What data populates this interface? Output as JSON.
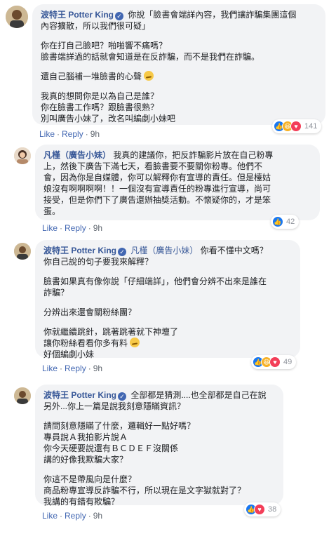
{
  "comments": [
    {
      "author": "波特王 Potter King",
      "mention": "",
      "paragraphs": [
        [
          "你說「臉書會端詳內容，我們讓詐騙集團這個",
          "內容擴散，所以我們很可疑」"
        ],
        [
          "你在打自己臉吧？啪啪響不痛嗎？",
          "臉書端詳過的話就會知道是在反詐騙，而不是我們在詐騙。"
        ],
        [
          "還自己腦補一堆臉書的心聲"
        ],
        [
          "我真的想問你是以為自己是誰？",
          "你在臉書工作嗎？跟臉書很熟？",
          "別叫廣告小妹了，改名叫編劇小妹吧"
        ]
      ],
      "actions": {
        "like": "Like",
        "reply": "Reply",
        "time": "9h"
      },
      "reactions": {
        "icons": [
          "like-icon",
          "haha-icon",
          "love-icon"
        ],
        "count": "141"
      }
    },
    {
      "author": "凡槿（廣告小妹）",
      "mention": "",
      "paragraphs": [
        [
          "我真的建議你，把反詐騙影片放在自己粉專",
          "上，然後下廣告下滿七天，看臉書要不要關你粉專。他們不",
          "會，因為你是自媒體，你可以解釋你有宣導的責任。但是檯姑",
          "娘沒有啊啊啊啊！！一個沒有宣導責任的粉專進行宣導，尚可",
          "接受，但是你們下了廣告還辦抽獎活動。不懷疑你的，才是笨",
          "蛋。"
        ]
      ],
      "actions": {
        "like": "Like",
        "reply": "Reply",
        "time": "9h"
      },
      "reactions": {
        "icons": [
          "like-icon"
        ],
        "count": "42"
      }
    },
    {
      "author": "波特王 Potter King",
      "mention": "凡槿（廣告小妹）",
      "paragraphs": [
        [
          "你看不懂中文嗎？",
          "你自己說的句子要我來解釋？"
        ],
        [
          "臉書如果真有像你說「仔細端詳」，他們會分辨不出來是誰在",
          "詐騙？"
        ],
        [
          "分辨出來還會關粉絲團？"
        ],
        [
          "你就繼續跳針，跳著跳著就下神壇了",
          "讓你粉絲看看你多有料",
          "好個編劇小妹"
        ]
      ],
      "actions": {
        "like": "Like",
        "reply": "Reply",
        "time": "9h"
      },
      "reactions": {
        "icons": [
          "like-icon",
          "haha-icon",
          "love-icon"
        ],
        "count": "49"
      }
    },
    {
      "author": "波特王 Potter King",
      "mention": "",
      "paragraphs": [
        [
          "全部都是猜測....也全部都是自己在說",
          "另外...你上一篇是說我刻意隱瞞資訊？"
        ],
        [
          "請問刻意隱瞞了什麼，邏輯好一點好嗎？",
          "專員說Ａ我拍影片說Ａ",
          "你今天硬要說還有ＢＣＤＥＦ沒關係",
          "講的好像我欺騙大家？"
        ],
        [
          "你這不是帶風向是什麼？",
          "商品粉專宣導反詐騙不行，所以現在是文字獄就對了？",
          "我講的有錯有欺騙？"
        ]
      ],
      "actions": {
        "like": "Like",
        "reply": "Reply",
        "time": "9h"
      },
      "reactions": {
        "icons": [
          "like-icon",
          "love-icon"
        ],
        "count": "38"
      }
    }
  ],
  "colors": {
    "author": "#385898",
    "bubble": "#f2f3f5",
    "action": "#4267b2",
    "like": "#1877f2",
    "haha": "#f7b125",
    "love": "#f33e58"
  }
}
